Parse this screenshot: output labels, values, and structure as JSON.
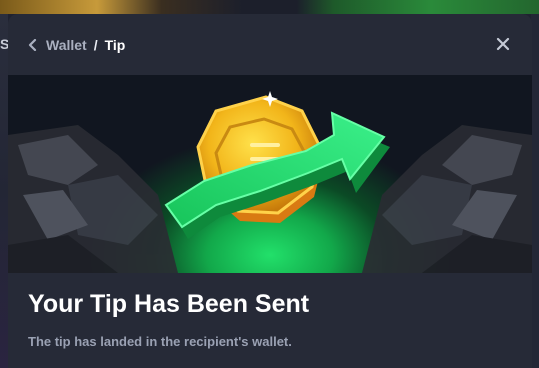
{
  "modal": {
    "breadcrumb": {
      "parent": "Wallet",
      "separator": "/",
      "current": "Tip"
    },
    "title": "Your Tip Has Been Sent",
    "subtitle": "The tip has landed in the recipient's wallet."
  },
  "background": {
    "edge_letter": "S"
  },
  "icons": {
    "back": "chevron-left-icon",
    "close": "close-icon"
  },
  "colors": {
    "modal_bg": "#262a37",
    "accent_green": "#22e06a",
    "coin_gold": "#f2b51a"
  }
}
